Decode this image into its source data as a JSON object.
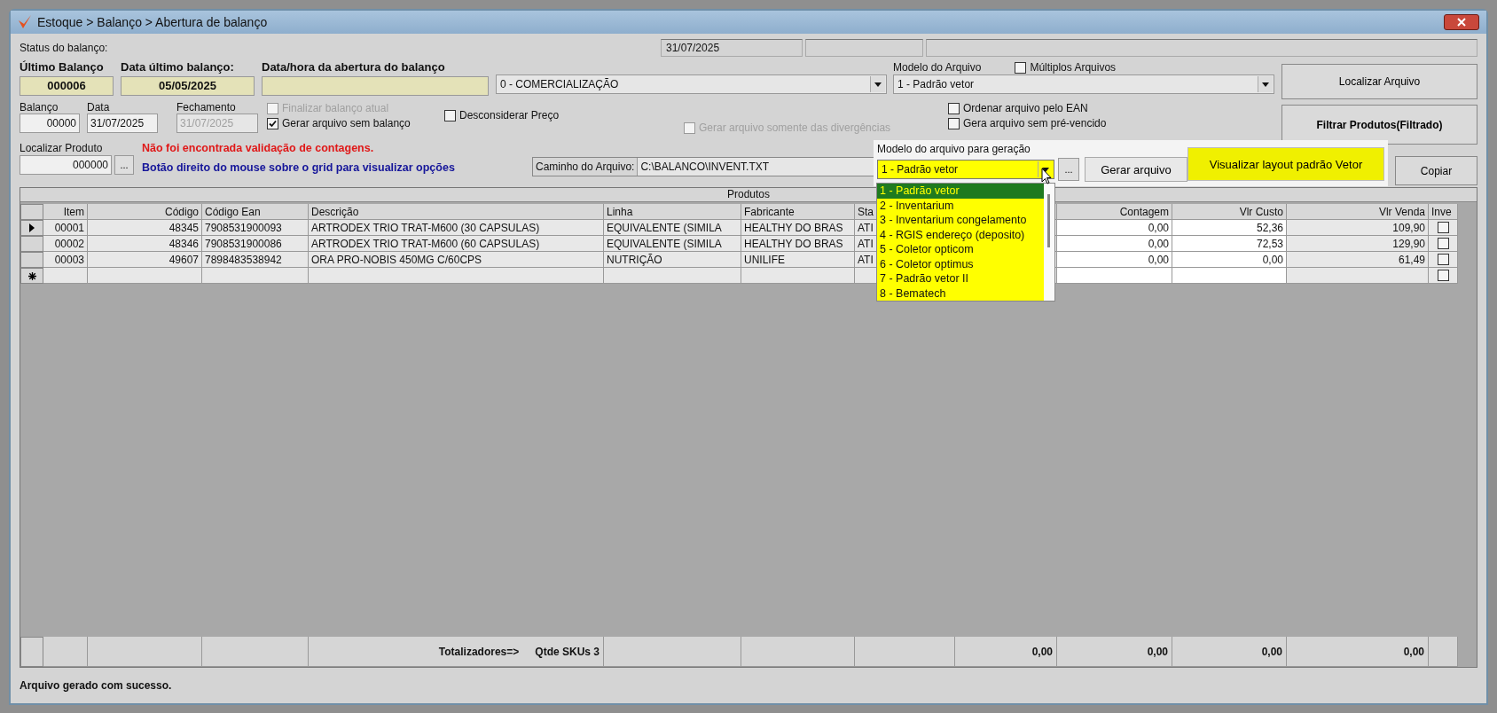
{
  "window": {
    "title": "Estoque > Balanço > Abertura de balanço"
  },
  "status": {
    "label": "Status do balanço:",
    "date": "31/07/2025"
  },
  "summary": [
    {
      "label": "Último Balanço",
      "value": "000006"
    },
    {
      "label": "Data último balanço:",
      "value": "05/05/2025"
    },
    {
      "label": "Data/hora da abertura do balanço"
    }
  ],
  "category_combo": {
    "value": "0 - COMERCIALIZAÇÃO"
  },
  "file_model": {
    "label": "Modelo do Arquivo",
    "value": "1 - Padrão vetor"
  },
  "multiple_files": {
    "label": "Múltiplos Arquivos",
    "checked": false
  },
  "balance_fields": [
    {
      "label": "Balanço",
      "value": "00000",
      "disabled": false
    },
    {
      "label": "Data",
      "value": "31/07/2025",
      "disabled": false
    },
    {
      "label": "Fechamento",
      "value": "31/07/2025",
      "disabled": true
    }
  ],
  "options": [
    {
      "label": "Finalizar balanço atual",
      "checked": false,
      "disabled": true
    },
    {
      "label": "Gerar arquivo sem balanço",
      "checked": true,
      "disabled": false
    },
    {
      "label": "Desconsiderar Preço",
      "checked": false,
      "disabled": false
    },
    {
      "label": "Gerar arquivo somente das divergências",
      "checked": false,
      "disabled": true
    },
    {
      "label": "Ordenar arquivo pelo EAN",
      "checked": false,
      "disabled": false
    },
    {
      "label": "Gera arquivo sem pré-vencido",
      "checked": false,
      "disabled": false
    }
  ],
  "buttons": {
    "locate_file": "Localizar Arquivo",
    "filter": "Filtrar Produtos(Filtrado)",
    "copy": "Copiar"
  },
  "product_search": {
    "label": "Localizar Produto",
    "value": "000000",
    "button": "..."
  },
  "messages": [
    {
      "kind": "error",
      "text": "Não foi encontrada validação de contagens."
    },
    {
      "kind": "hint",
      "text": "Botão direito do mouse sobre o grid para visualizar opções"
    }
  ],
  "file_path": {
    "label": "Caminho do Arquivo:",
    "value": "C:\\BALANCO\\INVENT.TXT"
  },
  "generation_popup": {
    "label": "Modelo do arquivo para geração",
    "value": "1 - Padrão vetor",
    "browse": "...",
    "generate": "Gerar arquivo",
    "view_layout": "Visualizar layout padrão Vetor",
    "expanded": true,
    "options": [
      {
        "label": "1 - Padrão vetor",
        "selected": true
      },
      {
        "label": "2 - Inventarium",
        "selected": false
      },
      {
        "label": "3 - Inventarium congelamento",
        "selected": false
      },
      {
        "label": "4 - RGIS endereço (deposito)",
        "selected": false
      },
      {
        "label": "5 - Coletor opticom",
        "selected": false
      },
      {
        "label": "6 - Coletor optimus",
        "selected": false
      },
      {
        "label": "7 - Padrão vetor II",
        "selected": false
      },
      {
        "label": "8 - Bematech",
        "selected": false
      }
    ]
  },
  "grid": {
    "title": "Produtos",
    "columns": [
      {
        "label": "Item"
      },
      {
        "label": "Código"
      },
      {
        "label": "Código Ean"
      },
      {
        "label": "Descrição"
      },
      {
        "label": "Linha"
      },
      {
        "label": "Fabricante"
      },
      {
        "label": "Sta"
      },
      {},
      {
        "label": "Contagem"
      },
      {
        "label": "Vlr Custo"
      },
      {
        "label": "Vlr Venda"
      },
      {
        "label": "Inve"
      }
    ],
    "rows": [
      {
        "kind": "data",
        "current": true,
        "inventoried": false,
        "cells": [
          "00001",
          "48345",
          "7908531900093",
          "ARTRODEX TRIO TRAT-M600 (30 CAPSULAS)",
          "EQUIVALENTE (SIMILA",
          "HEALTHY DO BRAS",
          "ATI",
          "0,00",
          "52,36",
          "109,90"
        ]
      },
      {
        "kind": "data",
        "current": false,
        "inventoried": false,
        "cells": [
          "00002",
          "48346",
          "7908531900086",
          "ARTRODEX TRIO TRAT-M600 (60 CAPSULAS)",
          "EQUIVALENTE (SIMILA",
          "HEALTHY DO BRAS",
          "ATI",
          "0,00",
          "72,53",
          "129,90"
        ]
      },
      {
        "kind": "data",
        "current": false,
        "inventoried": false,
        "cells": [
          "00003",
          "49607",
          "7898483538942",
          "ORA PRO-NOBIS 450MG C/60CPS",
          "NUTRIÇÃO",
          "UNILIFE",
          "ATI",
          "0,00",
          "0,00",
          "61,49"
        ]
      },
      {
        "kind": "new",
        "inventoried": false
      }
    ],
    "totals": {
      "label": "Totalizadores=>",
      "count": "Qtde SKUs 3",
      "values": [
        "0,00",
        "0,00",
        "0,00",
        "0,00"
      ]
    }
  },
  "status_bar": "Arquivo gerado com sucesso."
}
